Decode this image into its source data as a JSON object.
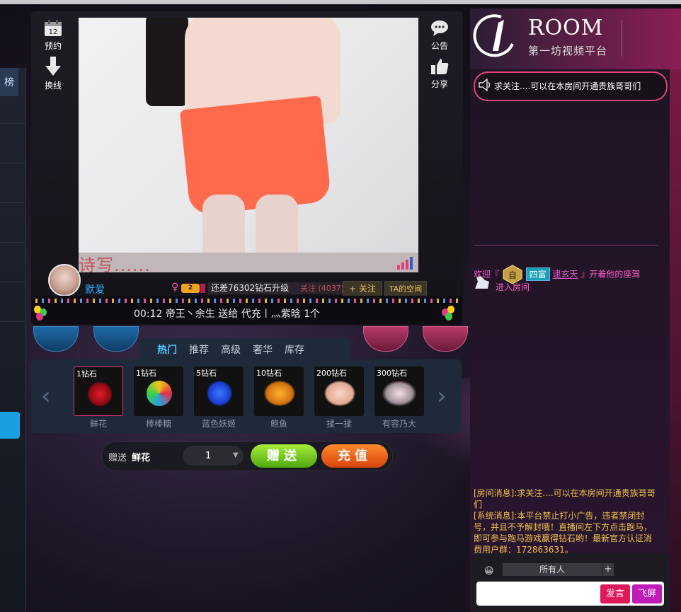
{
  "side_left": {
    "reserve_label": "预约",
    "reserve_icon": "calendar-icon",
    "reserve_day": "12",
    "switch_label": "换线",
    "switch_icon": "down-arrow-icon"
  },
  "side_right": {
    "notice_label": "公告",
    "notice_icon": "chat-bubble-icon",
    "share_label": "分享",
    "share_icon": "thumbs-up-icon"
  },
  "left_edge": {
    "tab_label": "榜"
  },
  "video": {
    "watermark": "诗写......"
  },
  "host": {
    "name": "默爱",
    "gender_symbol": "♀",
    "level": "2",
    "upgrade_text": "还差76302钻石升级",
    "follow_count_text": "关注 (4037)",
    "follow_button": "+ 关注",
    "space_button": "TA的空间"
  },
  "marquee": {
    "text": "00:12  帝王丶余生 送给 代充丨灬紫晗   1个"
  },
  "gift_tabs": [
    {
      "label": "热门",
      "active": true
    },
    {
      "label": "推荐",
      "active": false
    },
    {
      "label": "高级",
      "active": false
    },
    {
      "label": "奢华",
      "active": false
    },
    {
      "label": "库存",
      "active": false
    }
  ],
  "gifts": [
    {
      "price": "1钻石",
      "name": "鲜花",
      "color": "#c0101a",
      "selected": true
    },
    {
      "price": "1钻石",
      "name": "棒棒糖",
      "color": "#f0a020",
      "selected": false
    },
    {
      "price": "5钻石",
      "name": "蓝色妖姬",
      "color": "#1a5ae0",
      "selected": false
    },
    {
      "price": "10钻石",
      "name": "鲍鱼",
      "color": "#e07a10",
      "selected": false
    },
    {
      "price": "200钻石",
      "name": "揉一揉",
      "color": "#f2c4b0",
      "selected": false
    },
    {
      "price": "300钻石",
      "name": "有容乃大",
      "color": "#d8c0c8",
      "selected": false
    }
  ],
  "send": {
    "label": "赠送",
    "selected_gift": "鲜花",
    "quantity": "1",
    "give_button": "赠送",
    "charge_button": "充值"
  },
  "logo": {
    "title": "ROOM",
    "subtitle": "第一坊视频平台"
  },
  "notice": {
    "text": "求关注....可以在本房间开通贵族哥哥们"
  },
  "chat": {
    "welcome_prefix": "欢迎『",
    "badge_char": "自",
    "rich_label": "四富",
    "user": "逮玄天",
    "welcome_suffix": "』开着他的座驾",
    "enter_room": "进入房间"
  },
  "system_messages": [
    "[房间消息]:求关注....可以在本房间开通贵族哥哥们",
    "[系统消息]:本平台禁止打小广告，违者禁闭封号，并且不予解封哦！直播间左下方点击跑马，即可参与跑马游戏赢得钻石哟！最新官方认证消费用户群：172863631。"
  ],
  "input": {
    "target": "所有人",
    "target_plus": "+",
    "send_button": "发言",
    "fly_button": "飞屏"
  },
  "colors": {
    "accent_pink": "#e0407a",
    "accent_blue": "#2ab0ff",
    "give_green": "#6fcf1a",
    "charge_orange": "#f06a1a"
  }
}
